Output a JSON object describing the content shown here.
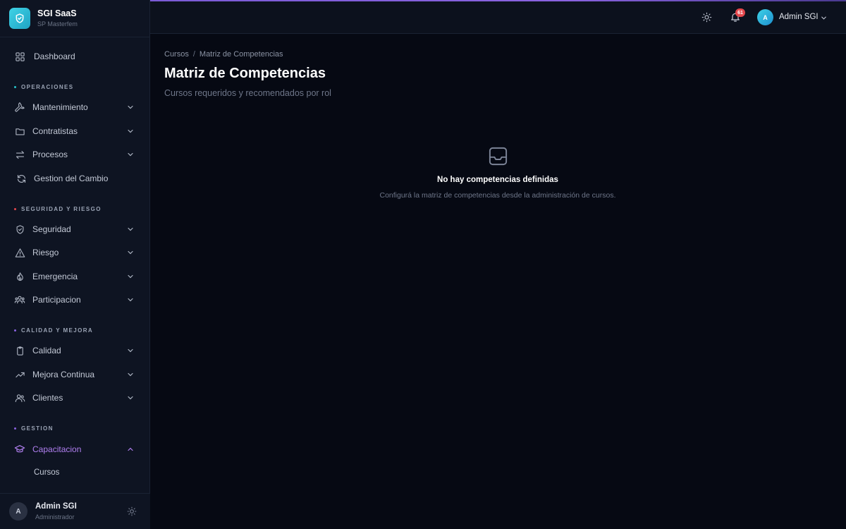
{
  "brand": {
    "title": "SGI SaaS",
    "subtitle": "SP Masterfem"
  },
  "sidebar": {
    "dashboard": "Dashboard",
    "sections": {
      "operaciones": {
        "label": "OPERACIONES",
        "color": "#27c2c9"
      },
      "seguridad": {
        "label": "SEGURIDAD Y RIESGO",
        "color": "#e5484d"
      },
      "calidad": {
        "label": "CALIDAD Y MEJORA",
        "color": "#8a63e0"
      },
      "gestion": {
        "label": "GESTION",
        "color": "#8a63e0"
      }
    },
    "items": {
      "mantenimiento": "Mantenimiento",
      "contratistas": "Contratistas",
      "procesos": "Procesos",
      "gestion_cambio": "Gestion del Cambio",
      "seguridad": "Seguridad",
      "riesgo": "Riesgo",
      "emergencia": "Emergencia",
      "participacion": "Participacion",
      "calidad": "Calidad",
      "mejora_continua": "Mejora Continua",
      "clientes": "Clientes",
      "capacitacion": "Capacitacion",
      "cursos": "Cursos"
    },
    "footer": {
      "initial": "A",
      "name": "Admin SGI",
      "role": "Administrador"
    }
  },
  "topbar": {
    "notifications": "61",
    "user_initial": "A",
    "user_name": "Admin SGI"
  },
  "main": {
    "breadcrumb": {
      "parent": "Cursos",
      "current": "Matriz de Competencias"
    },
    "title": "Matriz de Competencias",
    "subtitle": "Cursos requeridos y recomendados por rol",
    "empty": {
      "title": "No hay competencias definidas",
      "description": "Configurá la matriz de competencias desde la administración de cursos."
    }
  },
  "colors": {
    "accent": "#8a63e0",
    "active_text": "#b07ff0",
    "brand": "#27c2c9"
  }
}
